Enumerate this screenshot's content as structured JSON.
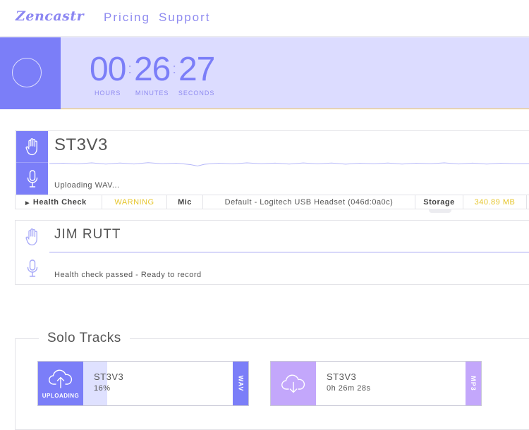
{
  "app": {
    "logo": "Zencastr"
  },
  "nav": [
    {
      "label": "Pricing"
    },
    {
      "label": "Support"
    }
  ],
  "timer": {
    "hours": "00",
    "minutes": "26",
    "seconds": "27",
    "hours_label": "HOURS",
    "minutes_label": "MINUTES",
    "seconds_label": "SECONDS"
  },
  "participants": [
    {
      "name": "ST3V3",
      "status": "Uploading WAV...",
      "health": {
        "toggle_label": "Health Check",
        "status": "WARNING",
        "mic_label": "Mic",
        "device": "Default - Logitech USB Headset (046d:0a0c)",
        "storage_label": "Storage",
        "storage_value": "340.89 MB"
      }
    },
    {
      "name": "JIM RUTT",
      "status": "Health check passed - Ready to record"
    }
  ],
  "solo": {
    "title": "Solo Tracks",
    "tracks": [
      {
        "name": "ST3V3",
        "sub": "16%",
        "state": "UPLOADING",
        "format": "WAV",
        "progress": 0.16
      },
      {
        "name": "ST3V3",
        "sub": "0h 26m 28s",
        "state": "",
        "format": "MP3"
      }
    ]
  },
  "colors": {
    "accent": "#7b7ef8",
    "accent_light": "#dcdcff",
    "mp3": "#c3a7fb",
    "warning": "#e6c52b"
  },
  "icons": [
    "hand-icon",
    "mic-icon",
    "cloud-upload-icon",
    "cloud-download-icon",
    "record-circle-icon",
    "triangle-right-icon"
  ]
}
